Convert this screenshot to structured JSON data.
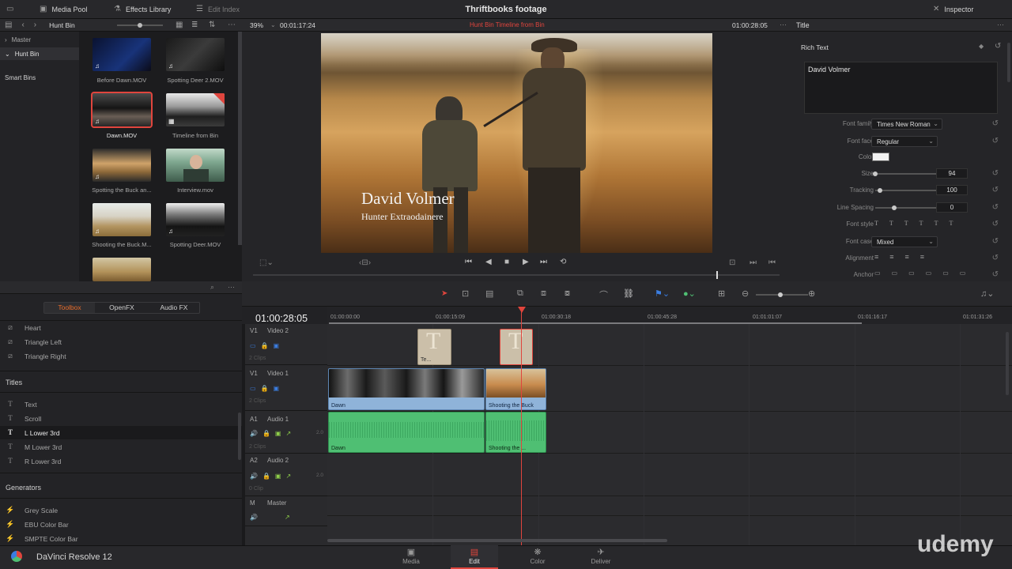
{
  "topbar": {
    "media_pool": "Media Pool",
    "effects_library": "Effects Library",
    "edit_index": "Edit Index",
    "title": "Thriftbooks footage",
    "inspector": "Inspector"
  },
  "media_pool": {
    "current_bin": "Hunt Bin",
    "bins": [
      "Master",
      "Hunt Bin"
    ],
    "smart_bins": "Smart Bins",
    "clips": [
      {
        "name": "Before Dawn.MOV",
        "selected": false
      },
      {
        "name": "Spotting Deer 2.MOV",
        "selected": false
      },
      {
        "name": "Dawn.MOV",
        "selected": true
      },
      {
        "name": "Timeline from Bin",
        "selected": false
      },
      {
        "name": "Spotting the Buck an...",
        "selected": false
      },
      {
        "name": "Interview.mov",
        "selected": false
      },
      {
        "name": "Shooting the Buck.M...",
        "selected": false
      },
      {
        "name": "Spotting Deer.MOV",
        "selected": false
      },
      {
        "name": "",
        "selected": false
      }
    ]
  },
  "viewer": {
    "zoom": "39%",
    "source_timecode": "00:01:17:24",
    "timeline_name": "Hunt Bin Timeline from Bin",
    "record_timecode": "01:00:28:05",
    "title_text": "David Volmer",
    "subtitle_text": "Hunter Extraodainere",
    "playhead_position": 0.88
  },
  "inspector": {
    "section": "Title",
    "rich_text_label": "Rich Text",
    "rich_text_value": "David Volmer",
    "font_family_label": "Font family",
    "font_family": "Times New Roman",
    "font_face_label": "Font face",
    "font_face": "Regular",
    "color_label": "Color",
    "color_value": "#f2f2f2",
    "size_label": "Size",
    "size": "94",
    "tracking_label": "Tracking",
    "tracking": "100",
    "line_spacing_label": "Line Spacing",
    "line_spacing": "0",
    "font_style_label": "Font style",
    "font_style_options": [
      "T",
      "T",
      "T",
      "T",
      "T",
      "T"
    ],
    "font_case_label": "Font case",
    "font_case": "Mixed",
    "alignment_label": "Alignment",
    "anchor_label": "Anchor"
  },
  "effects": {
    "tabs": [
      "Toolbox",
      "OpenFX",
      "Audio FX"
    ],
    "active_tab": "Toolbox",
    "transitions": [
      "Heart",
      "Triangle Left",
      "Triangle Right"
    ],
    "titles_header": "Titles",
    "titles": [
      "Text",
      "Scroll",
      "L Lower 3rd",
      "M Lower 3rd",
      "R Lower 3rd"
    ],
    "selected_title": "L Lower 3rd",
    "generators_header": "Generators",
    "generators": [
      "Grey Scale",
      "EBU Color Bar",
      "SMPTE Color Bar"
    ]
  },
  "timeline": {
    "timecode": "01:00:28:05",
    "ruler": [
      "01:00:00:00",
      "01:00:15:09",
      "01:00:30:18",
      "01:00:45:28",
      "01:01:01:07",
      "01:01:16:17",
      "01:01:31:26"
    ],
    "tracks": [
      {
        "id": "V1",
        "name": "Video 2",
        "clips": "2 Clips"
      },
      {
        "id": "V1",
        "name": "Video 1",
        "clips": "2 Clips"
      },
      {
        "id": "A1",
        "name": "Audio 1",
        "clips": "2 Clips",
        "level": "2.0"
      },
      {
        "id": "A2",
        "name": "Audio 2",
        "clips": "0 Clip",
        "level": "2.0"
      },
      {
        "id": "M",
        "name": "Master"
      }
    ],
    "title_clip_label": "Te...",
    "video_clips": [
      "Dawn",
      "Shooting the Buck"
    ],
    "audio_clips": [
      "Dawn",
      "Shooting the ..."
    ]
  },
  "pages": [
    "Media",
    "Edit",
    "Color",
    "Deliver"
  ],
  "active_page": "Edit",
  "app_name": "DaVinci Resolve 12",
  "watermark": "udemy",
  "colors": {
    "accent_red": "#e0453d",
    "audio_green": "#4fbf73",
    "video_blue": "#8fb3d9",
    "orange_tab": "#e86c2a"
  }
}
